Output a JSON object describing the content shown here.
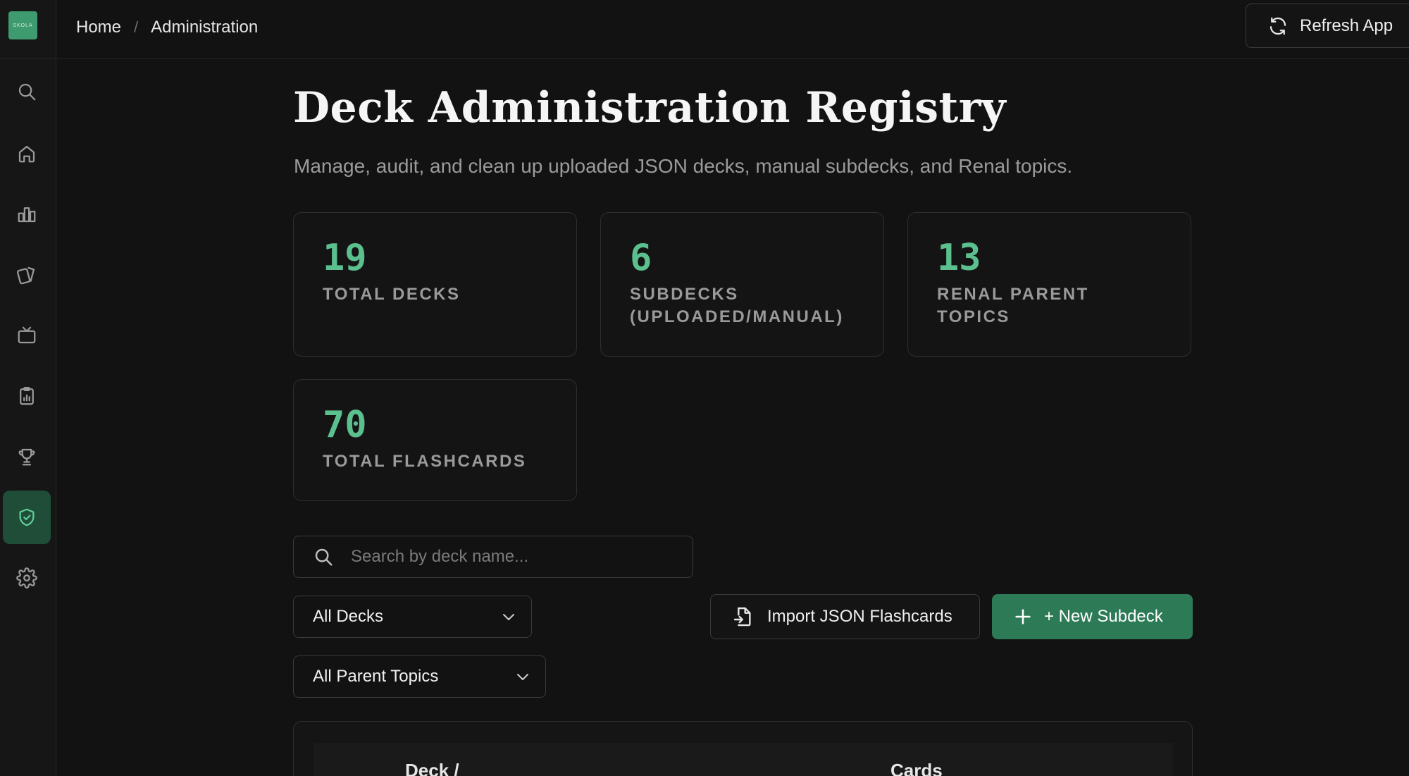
{
  "app": {
    "logo_text": "SKOLA"
  },
  "breadcrumb": {
    "home": "Home",
    "separator": "/",
    "current": "Administration"
  },
  "header": {
    "refresh_label": "Refresh App"
  },
  "sidebar": {
    "items": [
      {
        "icon": "search-icon"
      },
      {
        "icon": "home-icon"
      },
      {
        "icon": "bar-chart-icon"
      },
      {
        "icon": "cards-icon"
      },
      {
        "icon": "tv-icon"
      },
      {
        "icon": "clipboard-icon"
      },
      {
        "icon": "trophy-icon"
      },
      {
        "icon": "shield-check-icon",
        "active": true
      },
      {
        "icon": "gear-icon"
      }
    ]
  },
  "page": {
    "title": "Deck Administration Registry",
    "subtitle": "Manage, audit, and clean up uploaded JSON decks, manual subdecks, and Renal topics."
  },
  "stats": [
    {
      "value": "19",
      "label": "TOTAL DECKS"
    },
    {
      "value": "6",
      "label": "SUBDECKS (UPLOADED/MANUAL)"
    },
    {
      "value": "13",
      "label": "RENAL PARENT TOPICS"
    },
    {
      "value": "70",
      "label": "TOTAL FLASHCARDS"
    }
  ],
  "search": {
    "placeholder": "Search by deck name..."
  },
  "filters": {
    "deck_filter": "All Decks",
    "topic_filter": "All Parent Topics"
  },
  "actions": {
    "import_label": "Import JSON Flashcards",
    "new_subdeck_label": "+ New Subdeck"
  },
  "table": {
    "columns": [
      "Deck /",
      "Cards"
    ]
  },
  "colors": {
    "accent": "#5bbf8e",
    "primary_button": "#2d7a56",
    "active_nav": "#1f4d38"
  }
}
